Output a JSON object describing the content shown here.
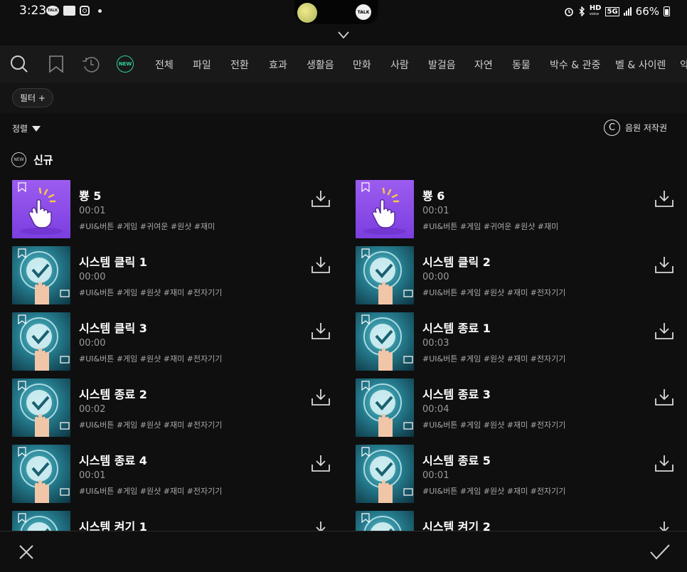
{
  "status_bar": {
    "time": "3:23",
    "battery": "66%",
    "notif_talk": "TALK",
    "pill_talk": "TALK",
    "hd_label": "HD",
    "voice_label": "voice",
    "network_label": "5G"
  },
  "tabs": {
    "new_label": "NEW",
    "items": [
      "전체",
      "파일",
      "전환",
      "효과",
      "생활음",
      "만화",
      "사람",
      "발걸음",
      "자연",
      "동물",
      "박수 & 관중",
      "벨 & 사이렌",
      "악"
    ]
  },
  "filter": {
    "label": "필터 +"
  },
  "sort": {
    "label": "정렬"
  },
  "copyright": {
    "symbol": "C",
    "label": "음원 저작권"
  },
  "section": {
    "badge": "NEW",
    "title": "신규"
  },
  "items": [
    {
      "title": "뿅 5",
      "duration": "00:01",
      "tags": "#UI&버튼  #게임  #귀여운  #원샷  #재미",
      "thumb": "purple"
    },
    {
      "title": "뿅 6",
      "duration": "00:01",
      "tags": "#UI&버튼  #게임  #귀여운  #원샷  #재미",
      "thumb": "purple"
    },
    {
      "title": "시스템 클릭 1",
      "duration": "00:00",
      "tags": "#UI&버튼  #게임  #원샷  #재미  #전자기기",
      "thumb": "teal"
    },
    {
      "title": "시스템 클릭 2",
      "duration": "00:00",
      "tags": "#UI&버튼  #게임  #원샷  #재미  #전자기기",
      "thumb": "teal"
    },
    {
      "title": "시스템 클릭 3",
      "duration": "00:00",
      "tags": "#UI&버튼  #게임  #원샷  #재미  #전자기기",
      "thumb": "teal"
    },
    {
      "title": "시스템 종료 1",
      "duration": "00:03",
      "tags": "#UI&버튼  #게임  #원샷  #재미  #전자기기",
      "thumb": "teal"
    },
    {
      "title": "시스템 종료 2",
      "duration": "00:02",
      "tags": "#UI&버튼  #게임  #원샷  #재미  #전자기기",
      "thumb": "teal"
    },
    {
      "title": "시스템 종료 3",
      "duration": "00:04",
      "tags": "#UI&버튼  #게임  #원샷  #재미  #전자기기",
      "thumb": "teal"
    },
    {
      "title": "시스템 종료 4",
      "duration": "00:01",
      "tags": "#UI&버튼  #게임  #원샷  #재미  #전자기기",
      "thumb": "teal"
    },
    {
      "title": "시스템 종료 5",
      "duration": "00:01",
      "tags": "#UI&버튼  #게임  #원샷  #재미  #전자기기",
      "thumb": "teal"
    },
    {
      "title": "시스템 켜기 1",
      "duration": "",
      "tags": "",
      "thumb": "teal"
    },
    {
      "title": "시스템 켜기 2",
      "duration": "",
      "tags": "",
      "thumb": "teal"
    }
  ],
  "bottom": {
    "close_icon": "close-icon",
    "confirm_icon": "check-icon"
  }
}
